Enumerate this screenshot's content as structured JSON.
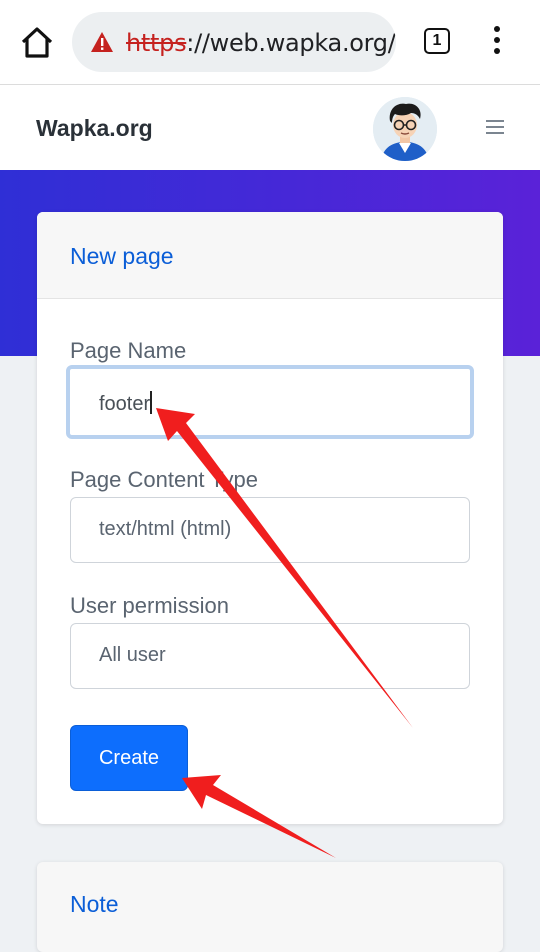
{
  "browser": {
    "url_scheme": "https",
    "url_rest": "://web.wapka.org/p",
    "tab_count": "1",
    "warning_color": "#c5221f"
  },
  "site": {
    "brand": "Wapka.org"
  },
  "form": {
    "title": "New page",
    "page_name_label": "Page Name",
    "page_name_value": "footer",
    "content_type_label": "Page Content Type",
    "content_type_value": "text/html (html)",
    "permission_label": "User permission",
    "permission_value": "All user",
    "create_label": "Create"
  },
  "note": {
    "title": "Note"
  },
  "colors": {
    "accent": "#0d6efd",
    "hero_start": "#2f2fd6",
    "hero_end": "#5a22d8",
    "annotation_arrow": "#f01e1e"
  },
  "icons": [
    "home-icon",
    "warning-icon",
    "tab-switcher-icon",
    "overflow-menu-icon",
    "hamburger-icon"
  ]
}
